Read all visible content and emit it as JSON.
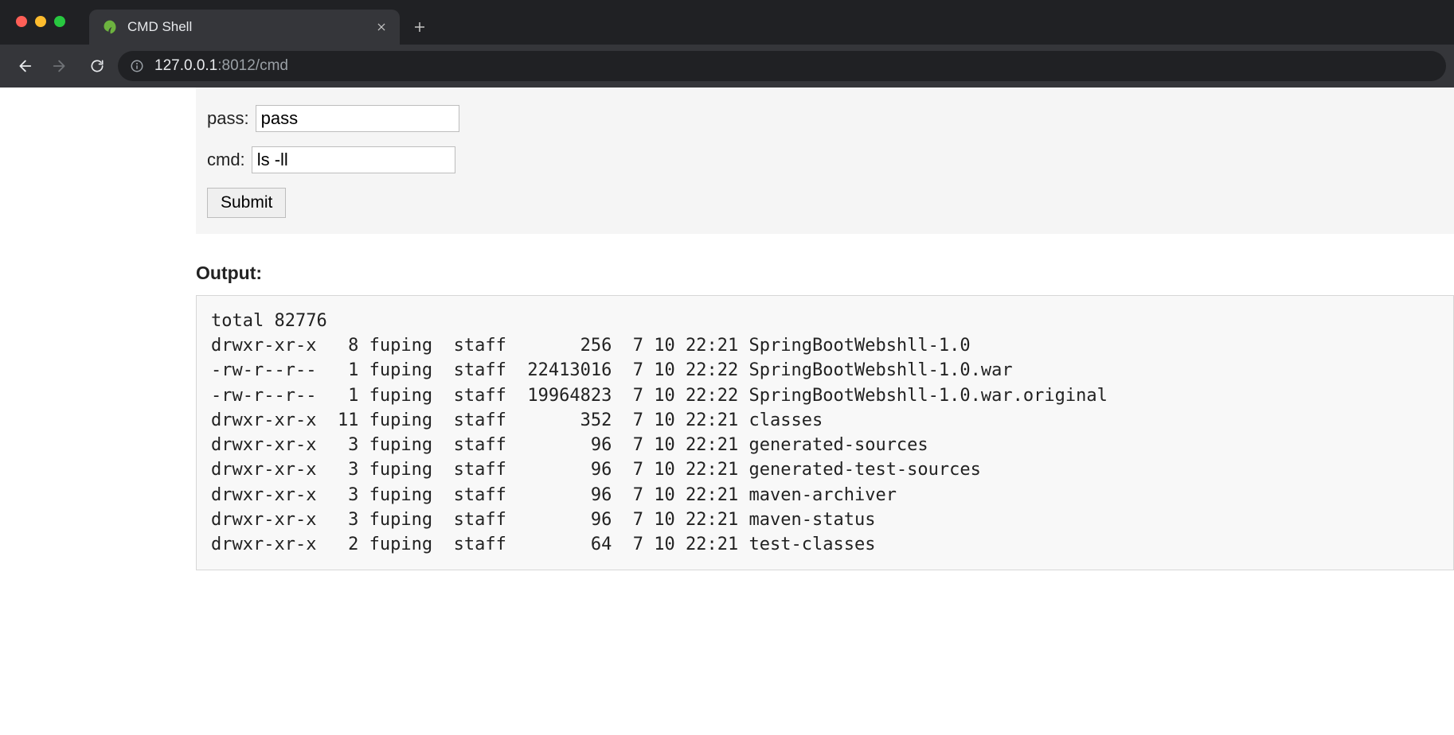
{
  "browser": {
    "tab_title": "CMD Shell",
    "url_host": "127.0.0.1",
    "url_port_path": ":8012/cmd"
  },
  "form": {
    "pass_label": "pass:",
    "pass_value": "pass",
    "cmd_label": "cmd:",
    "cmd_value": "ls -ll",
    "submit_label": "Submit"
  },
  "output": {
    "heading": "Output:",
    "text": "total 82776\ndrwxr-xr-x   8 fuping  staff       256  7 10 22:21 SpringBootWebshll-1.0\n-rw-r--r--   1 fuping  staff  22413016  7 10 22:22 SpringBootWebshll-1.0.war\n-rw-r--r--   1 fuping  staff  19964823  7 10 22:22 SpringBootWebshll-1.0.war.original\ndrwxr-xr-x  11 fuping  staff       352  7 10 22:21 classes\ndrwxr-xr-x   3 fuping  staff        96  7 10 22:21 generated-sources\ndrwxr-xr-x   3 fuping  staff        96  7 10 22:21 generated-test-sources\ndrwxr-xr-x   3 fuping  staff        96  7 10 22:21 maven-archiver\ndrwxr-xr-x   3 fuping  staff        96  7 10 22:21 maven-status\ndrwxr-xr-x   2 fuping  staff        64  7 10 22:21 test-classes"
  }
}
